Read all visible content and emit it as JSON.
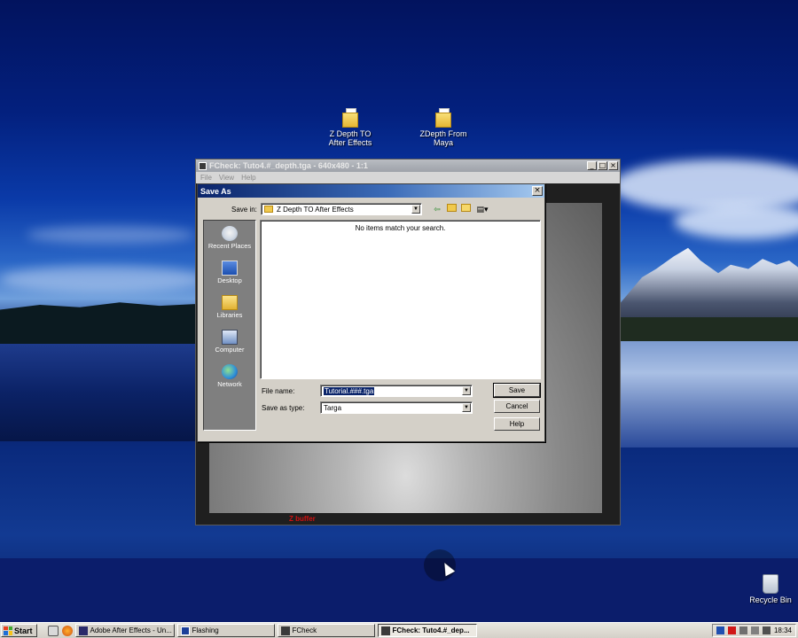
{
  "desktop": {
    "icons": [
      {
        "label_line1": "Z Depth TO",
        "label_line2": "After Effects",
        "icon": "folder-icon"
      },
      {
        "label_line1": "ZDepth From",
        "label_line2": "Maya",
        "icon": "folder-icon"
      },
      {
        "label_line1": "Recycle Bin",
        "label_line2": "",
        "icon": "recycle-bin-icon"
      }
    ]
  },
  "fcheck": {
    "title": "FCheck: Tuto4.#_depth.tga - 640x480 - 1:1",
    "menu": [
      "File",
      "View",
      "Help"
    ],
    "channel_label": "Z buffer"
  },
  "save_as": {
    "title": "Save As",
    "save_in_label": "Save in:",
    "save_in_value": "Z Depth TO After Effects",
    "places": [
      "Recent Places",
      "Desktop",
      "Libraries",
      "Computer",
      "Network"
    ],
    "empty_message": "No items match your search.",
    "file_name_label": "File name:",
    "file_name_value": "Tutorial.###.tga",
    "save_as_type_label": "Save as type:",
    "save_as_type_value": "Targa",
    "buttons": {
      "save": "Save",
      "cancel": "Cancel",
      "help": "Help"
    }
  },
  "taskbar": {
    "start_label": "Start",
    "tasks": [
      {
        "label": "Adobe After Effects - Un...",
        "active": false
      },
      {
        "label": "Flashing",
        "active": false
      },
      {
        "label": "FCheck",
        "active": false
      },
      {
        "label": "FCheck: Tuto4.#_dep...",
        "active": true
      }
    ],
    "clock": "18:34"
  },
  "colors": {
    "dialog_title_start": "#0a246a",
    "dialog_title_end": "#a6caf0",
    "zbuffer_label": "#d01010"
  }
}
